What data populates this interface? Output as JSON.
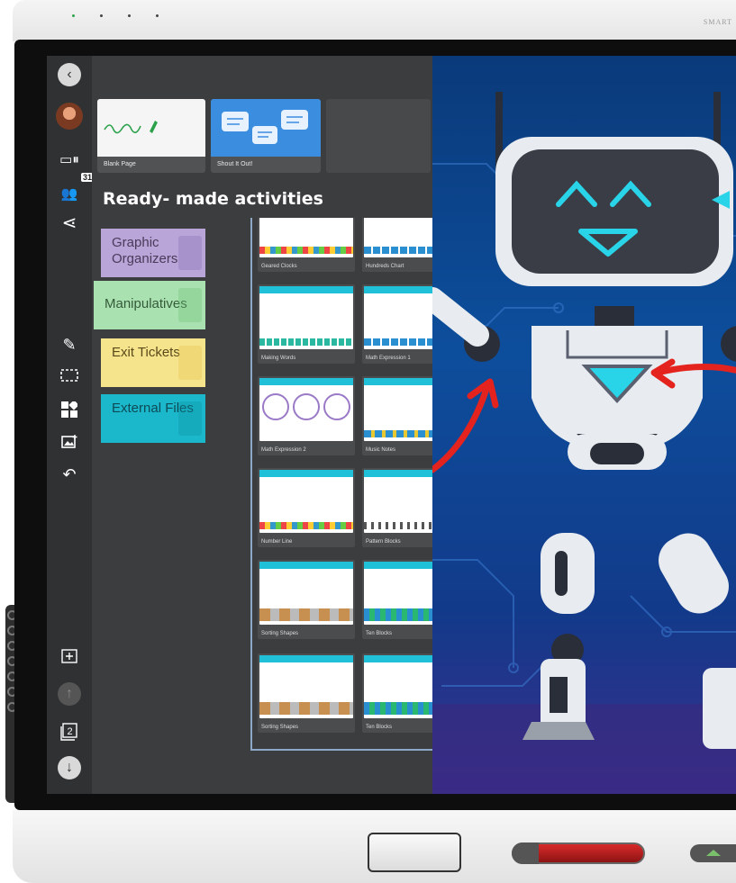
{
  "device": {
    "brand": "SMART"
  },
  "toolbar": {
    "top": [
      {
        "icon": "back-icon",
        "label": "‹"
      },
      {
        "icon": "avatar",
        "label": ""
      },
      {
        "icon": "layout-icon",
        "label": "▭Ⅱ"
      },
      {
        "icon": "participants-icon",
        "label": "👥",
        "badge": "31"
      },
      {
        "icon": "share-icon",
        "label": "≺"
      }
    ],
    "middle": [
      {
        "icon": "pen-icon",
        "label": "✎"
      },
      {
        "icon": "select-icon",
        "label": "⬚"
      },
      {
        "icon": "widgets-icon",
        "label": "▦"
      },
      {
        "icon": "add-image-icon",
        "label": "🖼"
      },
      {
        "icon": "undo-icon",
        "label": "↶"
      }
    ],
    "bottom": [
      {
        "icon": "add-page-icon",
        "label": "⊞"
      },
      {
        "icon": "up-icon",
        "label": "↑"
      },
      {
        "icon": "page-count-icon",
        "label": "2"
      },
      {
        "icon": "down-icon",
        "label": "↓"
      }
    ]
  },
  "templates": [
    {
      "label": "Blank Page"
    },
    {
      "label": "Shout It Out!"
    }
  ],
  "panel": {
    "heading": "Ready- made activities"
  },
  "categories": [
    {
      "label": "Graphic Organizers",
      "color": "#b9a5d8"
    },
    {
      "label": "Manipulatives",
      "color": "#a9e2b0"
    },
    {
      "label": "Exit Tickets",
      "color": "#f5e48c"
    },
    {
      "label": "External Files",
      "color": "#1bb8cc"
    }
  ],
  "activities": [
    {
      "label": "Geared Clocks"
    },
    {
      "label": "Hundreds Chart"
    },
    {
      "label": "Making Words"
    },
    {
      "label": "Math Expression 1"
    },
    {
      "label": "Math Expression 2"
    },
    {
      "label": "Music Notes"
    },
    {
      "label": "Number Line"
    },
    {
      "label": "Pattern Blocks"
    },
    {
      "label": "Sorting Shapes"
    },
    {
      "label": "Ten Blocks"
    },
    {
      "label": "Sorting Shapes"
    },
    {
      "label": "Ten Blocks"
    }
  ],
  "colors": {
    "accent_cyan": "#1fc0d8",
    "toolbar_bg": "#2f3133",
    "panel_bg": "#3b3d3f",
    "arrow_red": "#e5231e"
  }
}
